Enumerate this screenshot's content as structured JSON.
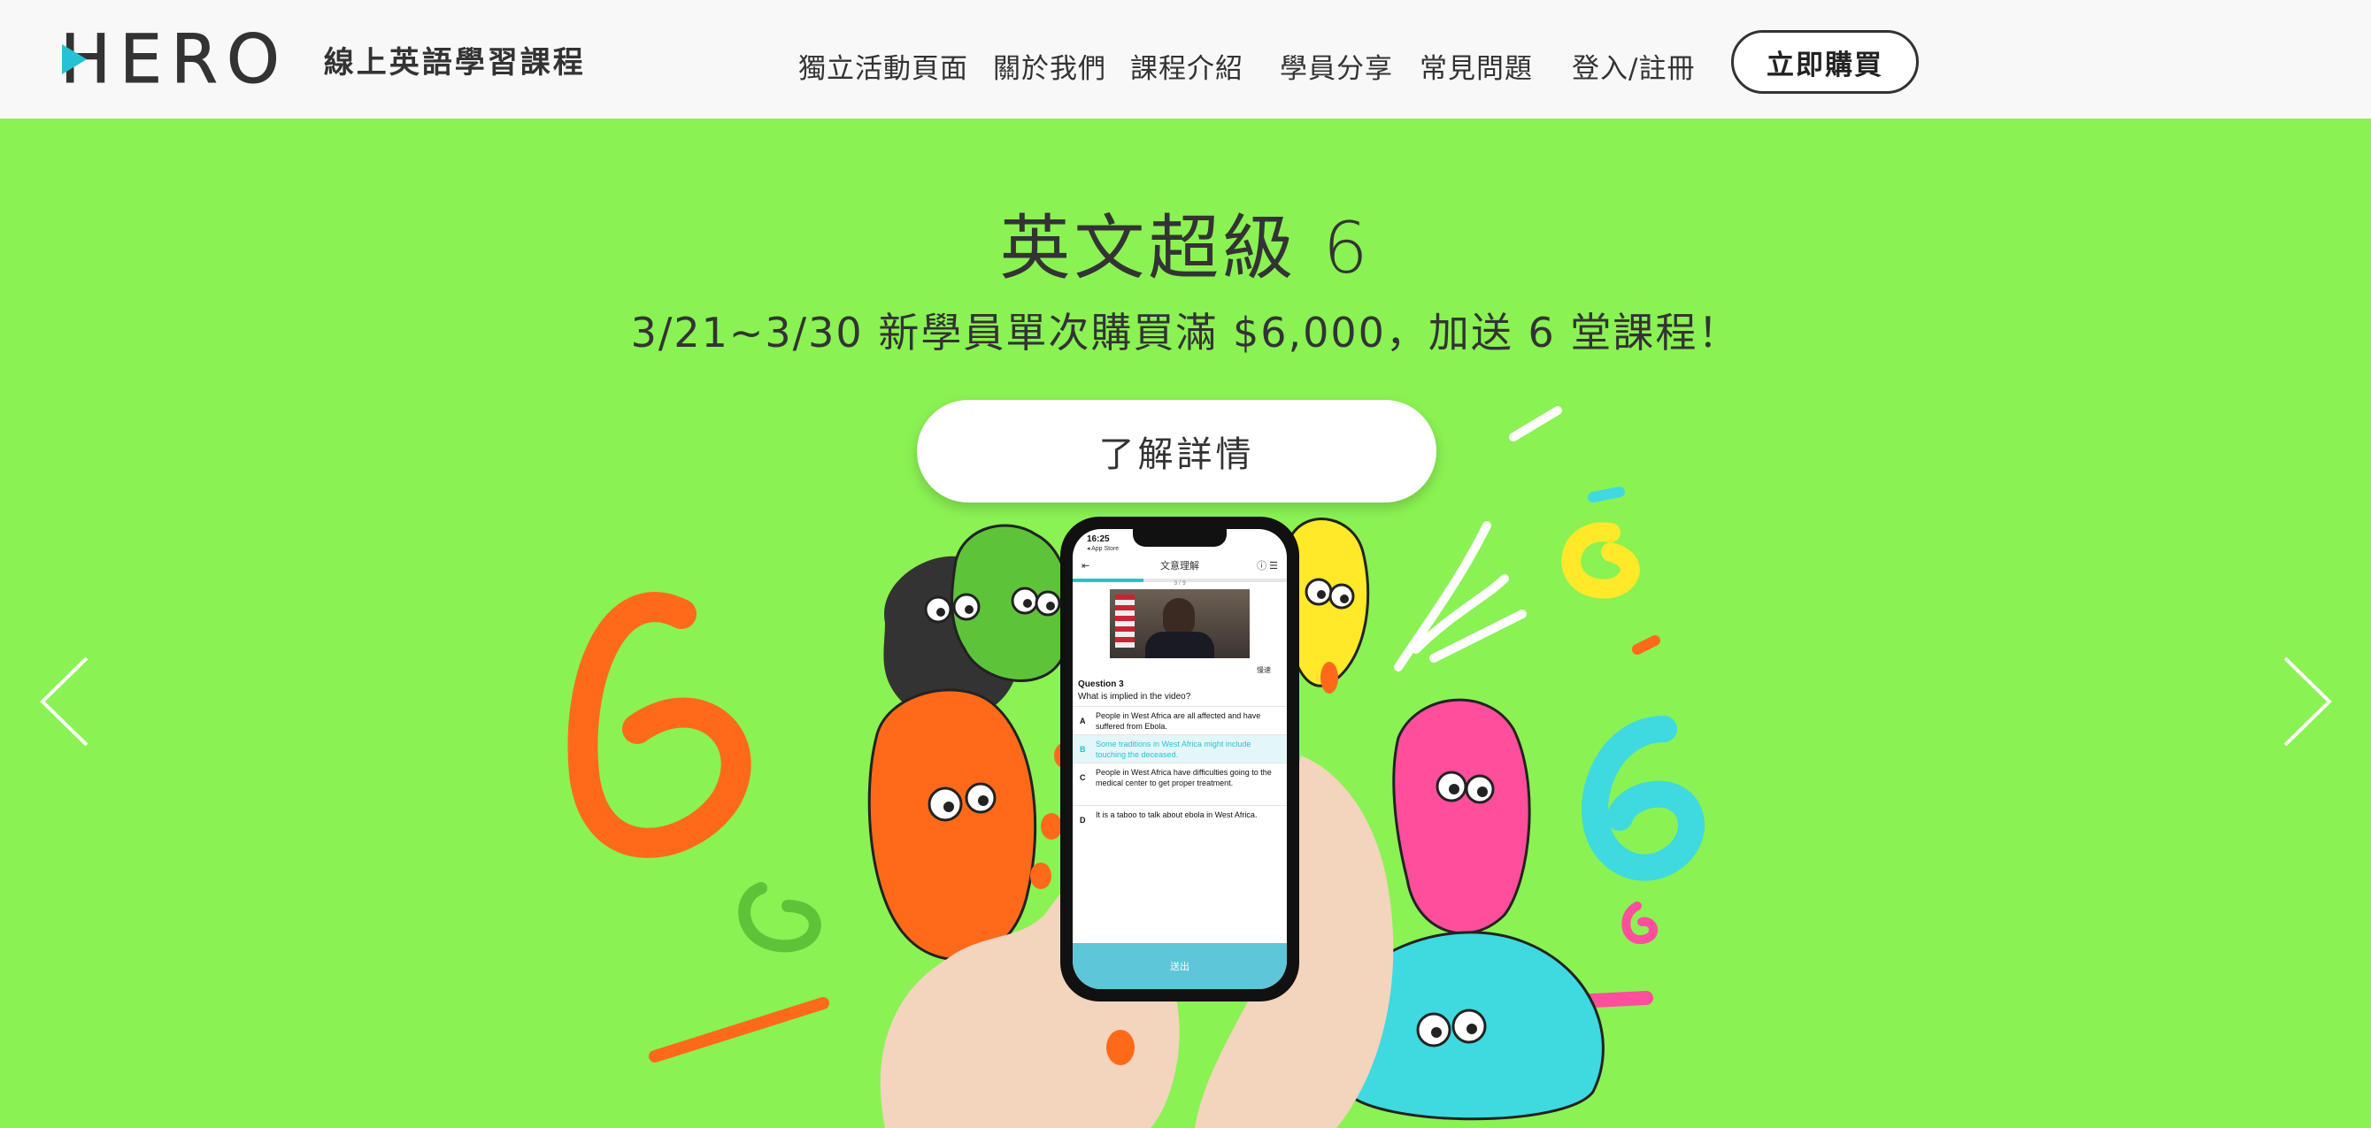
{
  "header": {
    "logo_text": "HERO",
    "logo_subtitle": "線上英語學習課程",
    "nav": [
      {
        "label": "獨立活動頁面"
      },
      {
        "label": "關於我們"
      },
      {
        "label": "課程介紹"
      },
      {
        "label": "學員分享"
      },
      {
        "label": "常見問題"
      },
      {
        "label": "登入/註冊"
      }
    ],
    "buy_label": "立即購買"
  },
  "banner": {
    "title": "英文超級 6",
    "subtitle": "3/21~3/30 新學員單次購買滿 $6,000，加送 6 堂課程！",
    "button_label": "了解詳情",
    "prev_icon": "chevron-left-icon",
    "next_icon": "chevron-right-icon",
    "background_color": "#8af253"
  },
  "phone": {
    "time": "16:25",
    "carrier": "◂ App Store",
    "screen_title": "文意理解",
    "progress_text": "3 / 9",
    "progress_fraction": 0.33,
    "speed_label": "慢速",
    "question_title": "Question 3",
    "question_text": "What is implied in the video?",
    "options": [
      {
        "key": "A",
        "text": "People in West Africa are all affected and have suffered from Ebola."
      },
      {
        "key": "B",
        "text": "Some traditions in West Africa might include touching the deceased."
      },
      {
        "key": "C",
        "text": "People in West Africa have difficulties going to the medical center to get proper treatment."
      },
      {
        "key": "D",
        "text": "It is a taboo to talk about ebola in West Africa."
      }
    ],
    "selected_option": "B",
    "submit_label": "送出"
  },
  "colors": {
    "accent": "#27c1d6",
    "orange": "#ff6a1a",
    "yellow": "#ffe928",
    "pink": "#ff4e9b",
    "cyan": "#3fd9e0"
  }
}
